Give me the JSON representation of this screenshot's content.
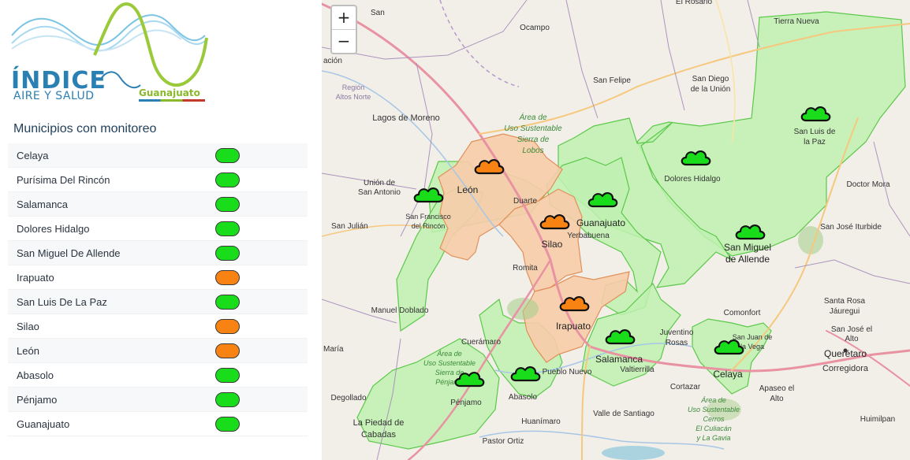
{
  "brand": {
    "title": "ÍNDICE",
    "subtitle": "AIRE Y SALUD",
    "region": "Guanajuato"
  },
  "colors": {
    "good": "#19dd1b",
    "moderate": "#f88312",
    "good_area": "#bff1b0",
    "moderate_area": "#f7ccaa"
  },
  "sidebar": {
    "title": "Municipios con monitoreo",
    "municipalities": [
      {
        "name": "Celaya",
        "status": "good"
      },
      {
        "name": "Purísima Del Rincón",
        "status": "good"
      },
      {
        "name": "Salamanca",
        "status": "good"
      },
      {
        "name": "Dolores Hidalgo",
        "status": "good"
      },
      {
        "name": "San Miguel De Allende",
        "status": "good"
      },
      {
        "name": "Irapuato",
        "status": "moderate"
      },
      {
        "name": "San Luis De La Paz",
        "status": "good"
      },
      {
        "name": "Silao",
        "status": "moderate"
      },
      {
        "name": "León",
        "status": "moderate"
      },
      {
        "name": "Abasolo",
        "status": "good"
      },
      {
        "name": "Pénjamo",
        "status": "good"
      },
      {
        "name": "Guanajuato",
        "status": "good"
      }
    ]
  },
  "map": {
    "zoom_in_label": "+",
    "zoom_out_label": "−",
    "place_labels": {
      "leon": "León",
      "guanajuato": "Guanajuato",
      "silao": "Silao",
      "irapuato": "Irapuato",
      "salamanca": "Salamanca",
      "celaya": "Celaya",
      "dolores": "Dolores Hidalgo",
      "san_miguel": "San Miguel",
      "de_allende": "de Allende",
      "san_luis": "San Luis de",
      "la_paz": "la Paz",
      "lagos": "Lagos de Moreno",
      "ocampo": "Ocampo",
      "san_felipe": "San Felipe",
      "san_diego": "San Diego",
      "de_la_union": "de la Unión",
      "tierra_nueva": "Tierra Nueva",
      "union": "Unión de",
      "san_antonio": "San Antonio",
      "sfr1": "San Francisco",
      "sfr2": "del Rincón",
      "san_julian": "San Julián",
      "duarte": "Duarte",
      "yerbabuena": "Yerbabuena",
      "romita": "Romita",
      "manuel_doblado": "Manuel Doblado",
      "cueramaro": "Cuerámaro",
      "abasolo": "Abasolo",
      "penjamo": "Pénjamo",
      "pueblo_nuevo": "Pueblo Nuevo",
      "valtierrilla": "Valtierrilla",
      "juventino": "Juventino",
      "rosas": "Rosas",
      "comonfort": "Comonfort",
      "sjv1": "San Juan de",
      "sjv2": "la Vega",
      "cortazar": "Cortazar",
      "apaseo1": "Apaseo el",
      "apaseo2": "Alto",
      "queretaro": "Querétaro",
      "corregidora": "Corregidora",
      "sjb1": "San José el",
      "sjb2": "Alto",
      "santa_rosa1": "Santa Rosa",
      "santa_rosa2": "Jáuregui",
      "sji": "San José Iturbide",
      "doctor_mora": "Doctor Mora",
      "valle": "Valle de Santiago",
      "huanimaro": "Huanímaro",
      "degollado": "Degollado",
      "la_piedad1": "La Piedad de",
      "la_piedad2": "Cabadas",
      "pastor": "Pastor Ortiz",
      "huimilpan": "Huimilpan",
      "maria": "María",
      "el_rosario": "El Rosario",
      "san_s": "San",
      "region1": "Región",
      "region2": "Altos Norte",
      "acion": "ación",
      "area1": "Área de",
      "area2": "Uso Sustentable",
      "area3": "Sierra de",
      "area4": "Lobos",
      "asp1": "Área de",
      "asp2": "Uso Sustentable",
      "asp3": "Sierra de",
      "asp4": "Pénjamo",
      "asc1": "Área de",
      "asc2": "Uso Sustentable",
      "asc3": "Cerros",
      "asc4": "El Culiacán",
      "asc5": "y La Gavia"
    }
  }
}
